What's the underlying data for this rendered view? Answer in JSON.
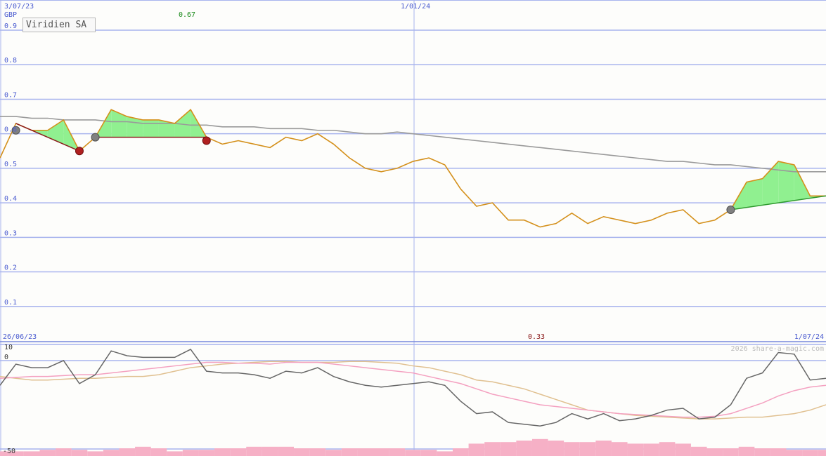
{
  "header": {
    "date_start": "3/07/23",
    "date_mid": "1/01/24",
    "currency": "GBP",
    "high_value": "0.67",
    "company": "Viridien SA"
  },
  "lower": {
    "date_start": "26/06/23",
    "low_value": "0.33",
    "date_end": "1/07/24",
    "copyright": "2026 share-a-magic.com",
    "y_top": "10",
    "y_zero": "0",
    "y_bottom": "-50"
  },
  "chart_data": [
    {
      "type": "line",
      "title": "Viridien SA",
      "ylabel": "GBP",
      "ylim": [
        0,
        0.9
      ],
      "yticks": [
        "0.1",
        "0.2",
        "0.3",
        "0.4",
        "0.5",
        "0.6",
        "0.7",
        "0.8",
        "0.9"
      ],
      "grid": true,
      "series": [
        {
          "values": [
            0.53,
            0.63,
            0.61,
            0.61,
            0.64,
            0.55,
            0.59,
            0.67,
            0.65,
            0.64,
            0.64,
            0.63,
            0.67,
            0.59,
            0.57,
            0.58,
            0.57,
            0.56,
            0.59,
            0.58,
            0.6,
            0.57,
            0.53,
            0.5,
            0.49,
            0.5,
            0.52,
            0.53,
            0.51,
            0.44,
            0.39,
            0.4,
            0.35,
            0.35,
            0.33,
            0.34,
            0.37,
            0.34,
            0.36,
            0.35,
            0.34,
            0.35,
            0.37,
            0.38,
            0.34,
            0.35,
            0.38,
            0.46,
            0.47,
            0.52,
            0.51,
            0.42,
            0.42
          ],
          "color": "#d4901b"
        },
        {
          "values": [
            0.65,
            0.65,
            0.645,
            0.645,
            0.64,
            0.64,
            0.64,
            0.635,
            0.635,
            0.63,
            0.63,
            0.63,
            0.625,
            0.625,
            0.62,
            0.62,
            0.62,
            0.615,
            0.615,
            0.615,
            0.61,
            0.61,
            0.605,
            0.6,
            0.6,
            0.605,
            0.6,
            0.595,
            0.59,
            0.585,
            0.58,
            0.575,
            0.57,
            0.565,
            0.56,
            0.555,
            0.55,
            0.545,
            0.54,
            0.535,
            0.53,
            0.525,
            0.52,
            0.52,
            0.515,
            0.51,
            0.51,
            0.505,
            0.5,
            0.495,
            0.49,
            0.49,
            0.49
          ],
          "color": "#9a9a9a"
        }
      ],
      "signals": [
        {
          "index": 1,
          "value": 0.61,
          "kind": "grey"
        },
        {
          "index": 5,
          "value": 0.55,
          "kind": "red"
        },
        {
          "index": 6,
          "value": 0.59,
          "kind": "grey"
        },
        {
          "index": 13,
          "value": 0.58,
          "kind": "red"
        },
        {
          "index": 46,
          "value": 0.38,
          "kind": "grey"
        }
      ],
      "trend_segments": [
        {
          "from": 1,
          "to": 5,
          "color": "#8b1a1a"
        },
        {
          "from": 6,
          "to": 13,
          "color": "#8b1a1a"
        },
        {
          "from": 46,
          "to": 52,
          "color": "#2e9a2e"
        }
      ]
    },
    {
      "type": "line",
      "ylim": [
        -50,
        10
      ],
      "yticks": [
        "10",
        "0",
        "-50"
      ],
      "series": [
        {
          "values": [
            -14,
            -2,
            -4,
            -4,
            0,
            -13,
            -8,
            6,
            3,
            2,
            2,
            2,
            7,
            -6,
            -7,
            -7,
            -8,
            -10,
            -6,
            -7,
            -4,
            -9,
            -12,
            -14,
            -15,
            -14,
            -13,
            -12,
            -14,
            -23,
            -30,
            -29,
            -35,
            -36,
            -37,
            -35,
            -30,
            -33,
            -30,
            -34,
            -33,
            -31,
            -28,
            -27,
            -33,
            -32,
            -25,
            -10,
            -7,
            5,
            4,
            -11,
            -10
          ],
          "color": "#666666"
        },
        {
          "values": [
            -10,
            -9.5,
            -9,
            -9,
            -8.5,
            -8,
            -8,
            -7,
            -6,
            -5,
            -4,
            -3,
            -2,
            -1,
            -1,
            -1.5,
            -1.5,
            -2,
            -1,
            -1,
            -1,
            -2,
            -3,
            -4,
            -5,
            -6,
            -7,
            -9,
            -11,
            -13,
            -16,
            -19,
            -21,
            -23,
            -25,
            -26,
            -27,
            -28,
            -29,
            -30,
            -30.5,
            -31,
            -31.5,
            -32,
            -32,
            -31.5,
            -30,
            -27,
            -24,
            -20,
            -17,
            -15,
            -14
          ],
          "color": "#f4a0c0"
        },
        {
          "values": [
            -9,
            -10,
            -11,
            -11,
            -10.5,
            -10,
            -10,
            -9.5,
            -9,
            -9,
            -8,
            -6,
            -4,
            -3,
            -2,
            -1.5,
            -1,
            -0.5,
            -0.5,
            -1,
            -1,
            -1,
            -0.5,
            -0.5,
            -1,
            -1.5,
            -3,
            -4,
            -6,
            -8,
            -11,
            -12,
            -14,
            -16,
            -19,
            -22,
            -25,
            -28,
            -29,
            -30,
            -31,
            -31.5,
            -32,
            -32.5,
            -33,
            -33,
            -32.5,
            -32,
            -32,
            -31,
            -30,
            -28,
            -25
          ],
          "color": "#e0c090"
        }
      ],
      "volume": [
        3,
        3,
        3,
        4,
        5,
        4,
        3,
        4,
        5,
        6,
        5,
        3,
        4,
        4,
        5,
        5,
        6,
        6,
        6,
        5,
        5,
        4,
        5,
        5,
        5,
        5,
        4,
        4,
        3,
        5,
        8,
        9,
        9,
        10,
        11,
        10,
        9,
        9,
        10,
        9,
        8,
        8,
        9,
        8,
        6,
        5,
        5,
        6,
        5,
        5,
        4,
        4,
        4
      ]
    }
  ]
}
